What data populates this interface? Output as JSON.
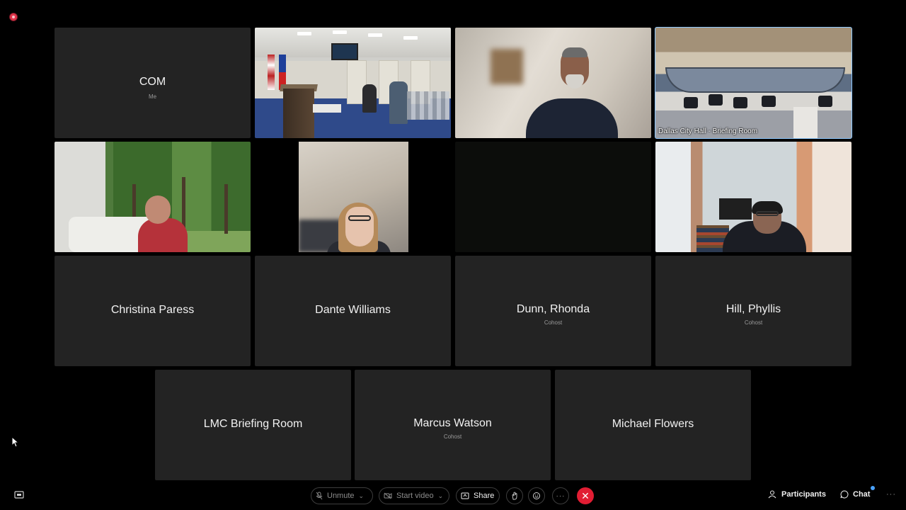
{
  "recording_indicator": {
    "color": "#e0344a"
  },
  "tiles": {
    "com": {
      "name": "COM",
      "sub": "Me"
    },
    "chamber": {
      "caption": "Dallas City Hall - Briefing Room"
    },
    "christina": {
      "name": "Christina Paress"
    },
    "dante": {
      "name": "Dante Williams"
    },
    "dunn": {
      "name": "Dunn, Rhonda",
      "sub": "Cohost"
    },
    "hill": {
      "name": "Hill, Phyllis",
      "sub": "Cohost"
    },
    "lmc": {
      "name": "LMC Briefing Room"
    },
    "marcus": {
      "name": "Marcus Watson",
      "sub": "Cohost"
    },
    "michael": {
      "name": "Michael Flowers"
    }
  },
  "active_speaker_color": "#8ec9ff",
  "toolbar": {
    "unmute_label": "Unmute",
    "start_video_label": "Start video",
    "share_label": "Share",
    "participants_label": "Participants",
    "chat_label": "Chat",
    "end_call_color": "#e11d33",
    "chat_notification_color": "#4aa3ff"
  }
}
